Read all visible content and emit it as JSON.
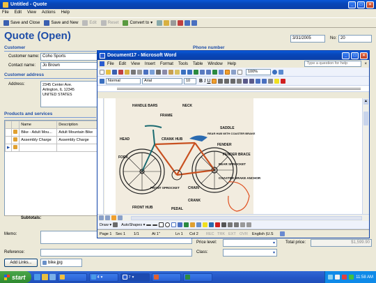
{
  "crm": {
    "title": "Untitled - Quote",
    "menu": [
      "File",
      "Edit",
      "View",
      "Actions",
      "Help"
    ],
    "toolbar": {
      "save_close": "Save and Close",
      "save_new": "Save and New",
      "edit": "Edit",
      "reset": "Reset",
      "convert": "Convert to"
    },
    "heading": "Quote (Open)",
    "date": "3/31/2005",
    "no_label": "No:",
    "no_value": "20",
    "phone_label": "Phone number",
    "customer_section": "Customer",
    "customer_name_label": "Customer name:",
    "customer_name": "Coho Sports",
    "contact_label": "Contact name:",
    "contact_name": "Jo Brown",
    "address_section": "Customer address",
    "address_label": "Address:",
    "address_lines": [
      "2345 Center Ave.",
      "Arlington, IL 12345",
      "UNITED STATES"
    ],
    "products_section": "Products and services",
    "grid_headers": [
      "Name",
      "Description"
    ],
    "grid_rows": [
      {
        "name": "Bike - Adult Mou...",
        "description": "Adult Mountain Bike"
      },
      {
        "name": "Assembly Charge",
        "description": "Assembly Charge"
      }
    ],
    "subtotals_label": "Subtotals:",
    "memo_label": "Memo:",
    "reference_label": "Reference:",
    "add_links": "Add Links...",
    "attachment": "bike.jpg",
    "price_level_label": "Price level:",
    "class_label": "Class:",
    "total_label": "Total price:",
    "total_value": "$1,599.90"
  },
  "word": {
    "title": "Document17 - Microsoft Word",
    "menu": [
      "File",
      "Edit",
      "View",
      "Insert",
      "Format",
      "Tools",
      "Table",
      "Window",
      "Help"
    ],
    "help_placeholder": "Type a question for help",
    "zoom": "100%",
    "style": "Normal",
    "font": "Arial",
    "size": "10",
    "draw": "Draw",
    "autoshapes": "AutoShapes",
    "status": [
      "Page 1",
      "Sec 1",
      "1/1",
      "At 1\"",
      "Ln 1",
      "Col 2",
      "REC",
      "TRK",
      "EXT",
      "OVR",
      "English (U.S"
    ],
    "sketch_labels": [
      "HANDLE BARS",
      "NECK",
      "FRAME",
      "SADDLE",
      "REAR HUB WITH COASTER BRAKE",
      "FENDER",
      "FENDER BRACE",
      "REAR SPROCKET",
      "CRANK HUB",
      "HEAD",
      "FORK",
      "CHAIN",
      "FRONT SPROCKET",
      "CRANK",
      "PEDAL",
      "FRONT HUB",
      "COASTER BRAKE ANCHOR"
    ]
  },
  "taskbar": {
    "start": "start",
    "time": "11:58 AM",
    "tasks": [
      "",
      "4",
      "7",
      "",
      ""
    ]
  }
}
